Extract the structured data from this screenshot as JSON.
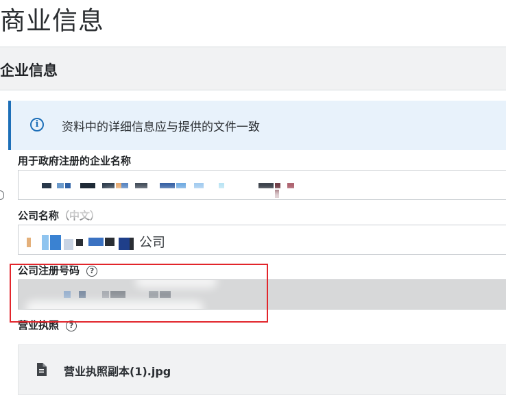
{
  "page": {
    "title": "商业信息"
  },
  "section": {
    "title": "企业信息"
  },
  "banner": {
    "icon": "info-icon",
    "text": "资料中的详细信息应与提供的文件一致",
    "accent_color": "#1d6fb8"
  },
  "fields": {
    "registered_name": {
      "label": "用于政府注册的企业名称",
      "value_redacted": true
    },
    "chinese_name": {
      "label": "公司名称（中文）",
      "value_visible_suffix": "公司",
      "value_redacted": true
    },
    "registration_number": {
      "label": "公司注册号码",
      "help_icon": "question-circle-icon",
      "disabled": true,
      "value_redacted": true
    },
    "business_license": {
      "label": "营业执照",
      "help_icon": "question-circle-icon",
      "file": {
        "icon": "document-icon",
        "name": "营业执照副本(1).jpg"
      }
    }
  },
  "annotation": {
    "highlight_color": "#e2252b",
    "target": "registration_number"
  }
}
